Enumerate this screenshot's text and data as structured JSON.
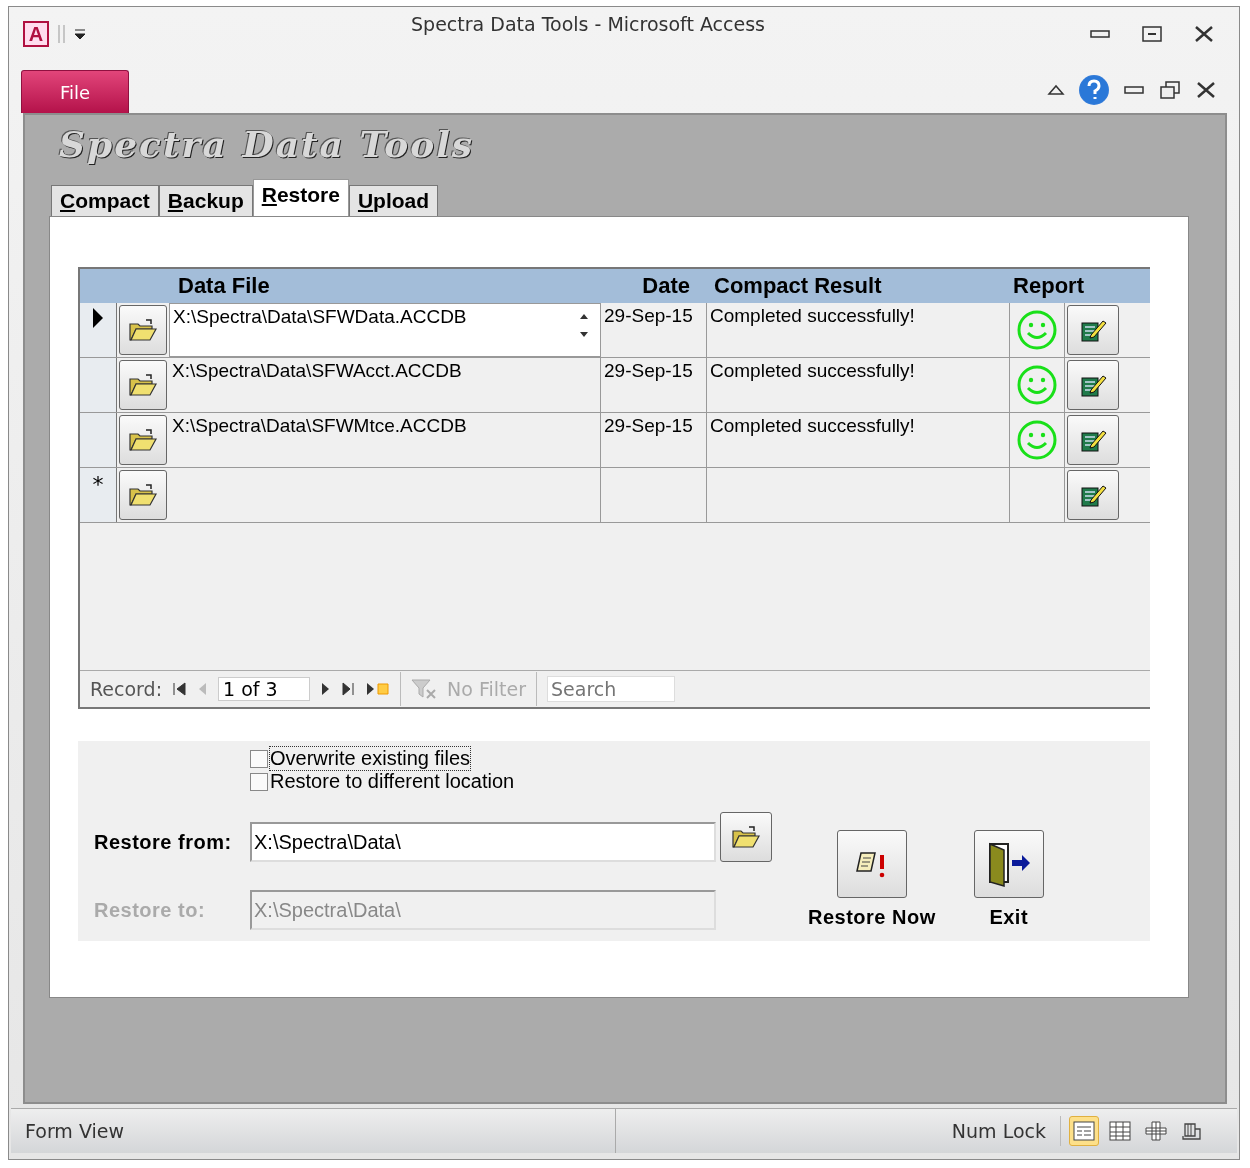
{
  "window": {
    "app_icon": "A",
    "title": "Spectra Data Tools  -  Microsoft Access"
  },
  "file_tab": "File",
  "form": {
    "title": "Spectra Data Tools",
    "tabs": [
      {
        "label": "Compact",
        "selected": false
      },
      {
        "label": "Backup",
        "selected": false
      },
      {
        "label": "Restore",
        "selected": true
      },
      {
        "label": "Upload",
        "selected": false
      }
    ],
    "grid": {
      "columns": [
        "Data File",
        "Date",
        "Compact Result",
        "Report"
      ],
      "rows": [
        {
          "data_file": "X:\\Spectra\\Data\\SFWData.ACCDB",
          "date": "29-Sep-15",
          "result": "Completed successfully!",
          "selected": true
        },
        {
          "data_file": "X:\\Spectra\\Data\\SFWAcct.ACCDB",
          "date": "29-Sep-15",
          "result": "Completed successfully!",
          "selected": false
        },
        {
          "data_file": "X:\\Spectra\\Data\\SFWMtce.ACCDB",
          "date": "29-Sep-15",
          "result": "Completed successfully!",
          "selected": false
        }
      ],
      "new_row_marker": "*"
    },
    "navigator": {
      "label": "Record:",
      "position": "1 of 3",
      "filter": "No Filter",
      "search_placeholder": "Search"
    },
    "options": {
      "checkboxes": [
        {
          "label": "Overwrite existing files",
          "checked": false
        },
        {
          "label": "Restore to different location",
          "checked": false
        }
      ],
      "fields": [
        {
          "label": "Restore from:",
          "value": "X:\\Spectra\\Data\\",
          "disabled": false
        },
        {
          "label": "Restore to:",
          "value": "X:\\Spectra\\Data\\",
          "disabled": true
        }
      ],
      "buttons": [
        {
          "label": "Restore Now",
          "kind": "restore"
        },
        {
          "label": "Exit",
          "kind": "exit"
        }
      ]
    }
  },
  "status_bar": {
    "left": "Form View",
    "right": "Num Lock",
    "views": [
      {
        "kind": "form",
        "selected": true
      },
      {
        "kind": "datasheet",
        "selected": false
      },
      {
        "kind": "pivot",
        "selected": false
      },
      {
        "kind": "layout",
        "selected": false
      }
    ]
  }
}
